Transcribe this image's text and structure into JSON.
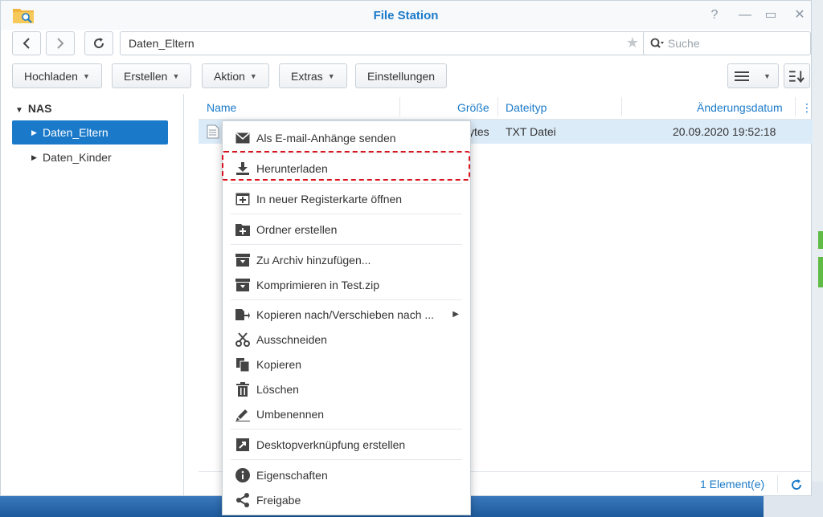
{
  "window": {
    "title": "File Station"
  },
  "nav": {
    "path": "Daten_Eltern",
    "search_placeholder": "Suche"
  },
  "toolbar": {
    "upload": "Hochladen",
    "create": "Erstellen",
    "action": "Aktion",
    "extras": "Extras",
    "settings": "Einstellungen"
  },
  "sidebar": {
    "root": "NAS",
    "items": [
      {
        "label": "Daten_Eltern"
      },
      {
        "label": "Daten_Kinder"
      }
    ]
  },
  "table": {
    "columns": {
      "name": "Name",
      "size": "Größe",
      "type": "Dateityp",
      "modified": "Änderungsdatum"
    },
    "rows": [
      {
        "size": "ytes",
        "type": "TXT Datei",
        "modified": "20.09.2020 19:52:18"
      }
    ],
    "footer_count": "1 Element(e)"
  },
  "context_menu": {
    "items": [
      {
        "label": "Als E-mail-Anhänge senden",
        "icon": "mail-icon"
      },
      {
        "label": "Herunterladen",
        "icon": "download-icon"
      },
      {
        "label": "In neuer Registerkarte öffnen",
        "icon": "new-tab-icon"
      },
      {
        "label": "Ordner erstellen",
        "icon": "folder-add-icon"
      },
      {
        "label": "Zu Archiv hinzufügen...",
        "icon": "archive-icon"
      },
      {
        "label": "Komprimieren in Test.zip",
        "icon": "compress-icon"
      },
      {
        "label": "Kopieren nach/Verschieben nach ...",
        "icon": "copy-move-icon"
      },
      {
        "label": "Ausschneiden",
        "icon": "scissors-icon"
      },
      {
        "label": "Kopieren",
        "icon": "copy-icon"
      },
      {
        "label": "Löschen",
        "icon": "trash-icon"
      },
      {
        "label": "Umbenennen",
        "icon": "pencil-icon"
      },
      {
        "label": "Desktopverknüpfung erstellen",
        "icon": "shortcut-icon"
      },
      {
        "label": "Eigenschaften",
        "icon": "info-icon"
      },
      {
        "label": "Freigabe",
        "icon": "share-icon"
      }
    ]
  },
  "colors": {
    "accent": "#1a7ac9",
    "selection": "#dcebf8",
    "highlight_border": "#d9141e"
  }
}
